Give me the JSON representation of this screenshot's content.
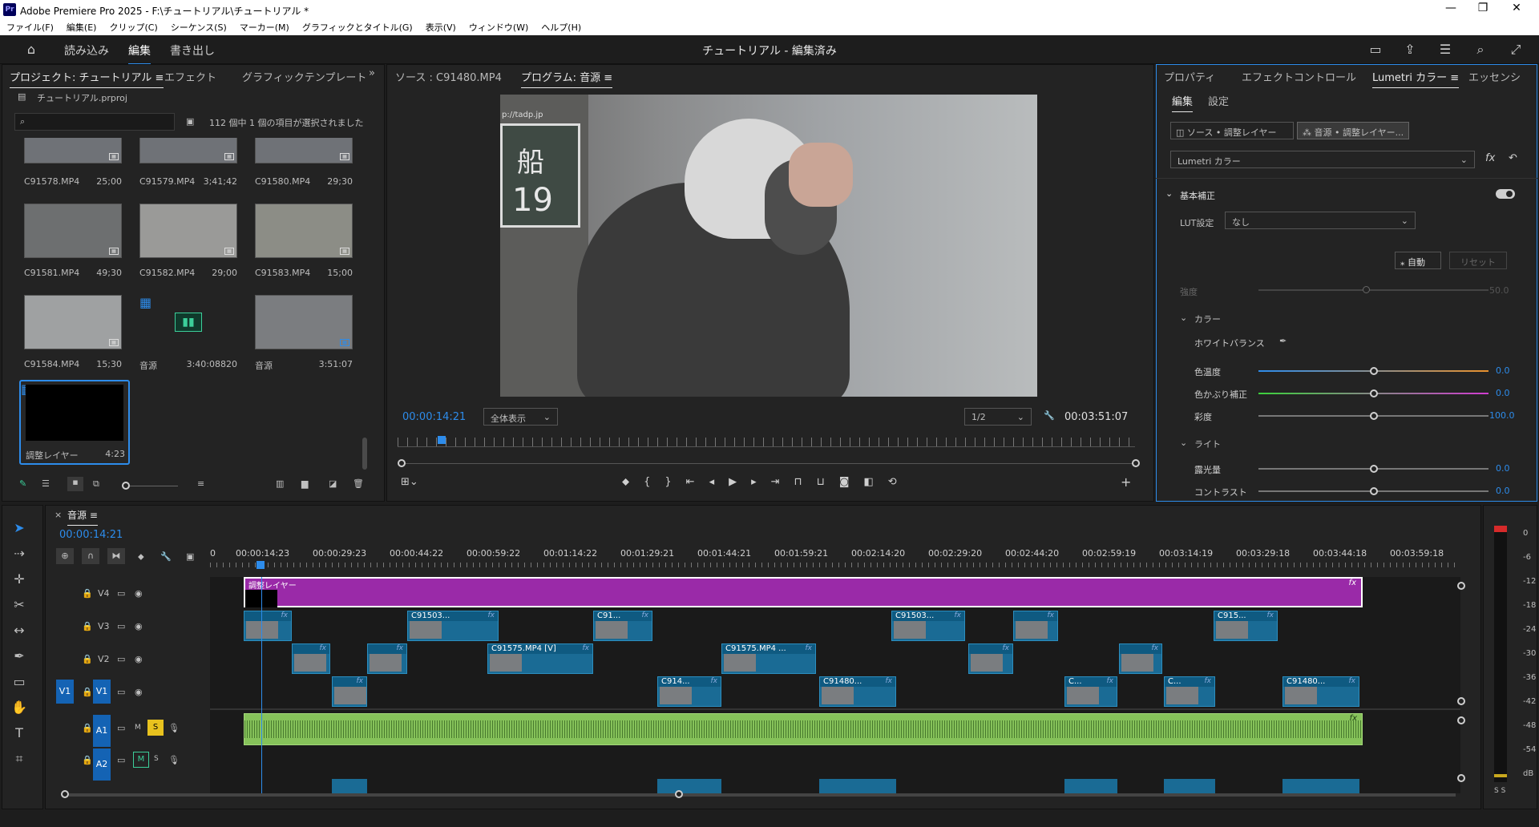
{
  "titlebar": {
    "logo": "Pr",
    "title": "Adobe Premiere Pro 2025 - F:\\チュートリアル\\チュートリアル *",
    "minimize": "—",
    "maximize": "❐",
    "close": "✕"
  },
  "menu": [
    "ファイル(F)",
    "編集(E)",
    "クリップ(C)",
    "シーケンス(S)",
    "マーカー(M)",
    "グラフィックとタイトル(G)",
    "表示(V)",
    "ウィンドウ(W)",
    "ヘルプ(H)"
  ],
  "header": {
    "home_icon": "home-icon",
    "workspaces": [
      "読み込み",
      "編集",
      "書き出し"
    ],
    "active": "編集",
    "document": "チュートリアル - 編集済み"
  },
  "project": {
    "tabs": [
      "プロジェクト: チュートリアル ≡",
      "エフェクト",
      "グラフィックテンプレート"
    ],
    "more": "»",
    "file": "チュートリアル.prproj",
    "search_placeholder": "",
    "selection_info": "112 個中 1 個の項目が選択されました",
    "items": [
      {
        "name": "C91578.MP4",
        "dur": "25;00"
      },
      {
        "name": "C91579.MP4",
        "dur": "3;41;42"
      },
      {
        "name": "C91580.MP4",
        "dur": "29;30"
      },
      {
        "name": "C91581.MP4",
        "dur": "49;30"
      },
      {
        "name": "C91582.MP4",
        "dur": "29;00"
      },
      {
        "name": "C91583.MP4",
        "dur": "15;00"
      },
      {
        "name": "C91584.MP4",
        "dur": "15;30"
      },
      {
        "name": "音源",
        "dur": "3:40:08820"
      },
      {
        "name": "音源",
        "dur": "3:51:07"
      },
      {
        "name": "調整レイヤー",
        "dur": "4:23"
      }
    ]
  },
  "source_tab": "ソース : C91480.MP4",
  "program": {
    "tab": "プログラム: 音源 ≡",
    "timecode": "00:00:14:21",
    "zoom": "全体表示",
    "resolution": "1/2",
    "duration": "00:03:51:07",
    "sign_text_1": "船",
    "sign_text_2": "19",
    "sign_url": "p://tadp.jp",
    "playhead_fraction": 0.06
  },
  "lumetri": {
    "tabs": [
      "プロパティ",
      "エフェクトコントロール",
      "Lumetri カラー ≡",
      "エッセンシ"
    ],
    "subtabs": [
      "編集",
      "設定"
    ],
    "source_btn": "ソース • 調整レイヤー",
    "target_btn": "音源 • 調整レイヤー...",
    "effect": "Lumetri カラー",
    "fx": "fx",
    "section": "基本補正",
    "lut_label": "LUT設定",
    "lut_value": "なし",
    "auto": "自動",
    "reset": "リセット",
    "intensity_label": "強度",
    "intensity_value": "50.0",
    "color_section": "カラー",
    "wb": "ホワイトバランス",
    "temp_label": "色温度",
    "temp_value": "0.0",
    "tint_label": "色かぶり補正",
    "tint_value": "0.0",
    "sat_label": "彩度",
    "sat_value": "100.0",
    "light_section": "ライト",
    "exposure_label": "露光量",
    "exposure_value": "0.0",
    "contrast_label": "コントラスト",
    "contrast_value": "0.0"
  },
  "timeline": {
    "close": "×",
    "tab": "音源 ≡",
    "timecode": "00:00:14:21",
    "ruler": [
      "0",
      "00:00:14:23",
      "00:00:29:23",
      "00:00:44:22",
      "00:00:59:22",
      "00:01:14:22",
      "00:01:29:21",
      "00:01:44:21",
      "00:01:59:21",
      "00:02:14:20",
      "00:02:29:20",
      "00:02:44:20",
      "00:02:59:19",
      "00:03:14:19",
      "00:03:29:18",
      "00:03:44:18",
      "00:03:59:18"
    ],
    "tracks": [
      "V4",
      "V3",
      "V2",
      "V1",
      "A1",
      "A2"
    ],
    "source_v": "V1",
    "mute": "M",
    "solo": "S",
    "adj_clip": "調整レイヤー",
    "v3_clips": [
      "",
      "C91503...",
      "C91...",
      "C91503...",
      "",
      "C915..."
    ],
    "v2_clips": [
      "",
      "",
      "C91575.MP4 [V]",
      "C91575.MP4 ...",
      "",
      ""
    ],
    "v1_clips": [
      "",
      "C914...",
      "C91480...",
      "C...",
      "C...",
      "C91480..."
    ]
  },
  "meter": {
    "labels": [
      "0",
      "-6",
      "-12",
      "-18",
      "-24",
      "-30",
      "-36",
      "-42",
      "-48",
      "-54",
      "dB"
    ],
    "solo_btns": "S S"
  },
  "colors": {
    "accent": "#2d8ceb",
    "adjustment": "#9a2aa8",
    "video_clip": "#1a6b95",
    "audio_clip": "#86c25a"
  }
}
